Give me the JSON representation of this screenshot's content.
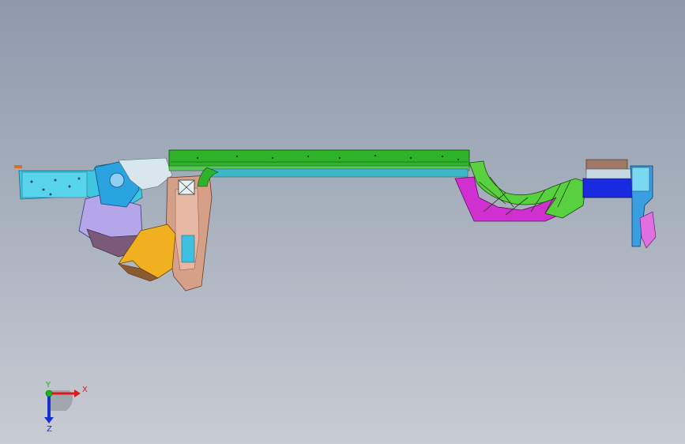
{
  "viewport": {
    "background_top": "#8e9aab",
    "background_bottom": "#c8ccd3"
  },
  "triad": {
    "x_label": "X",
    "y_label": "Y",
    "z_label": "Z",
    "x_color": "#e01818",
    "y_color": "#18b818",
    "z_color": "#1830d0"
  },
  "model": {
    "part_colors": {
      "front_rail": "#3fc6e0",
      "sill_beam": "#2fb32a",
      "front_pillar": "#d6a088",
      "wheel_arch_bracket": "#f0b020",
      "rear_arch": "#d030d0",
      "rear_arch_frame": "#58d040",
      "rear_block": "#1a2ae0",
      "rear_bracket": "#3a9fe0",
      "rear_top": "#a0786a"
    }
  }
}
